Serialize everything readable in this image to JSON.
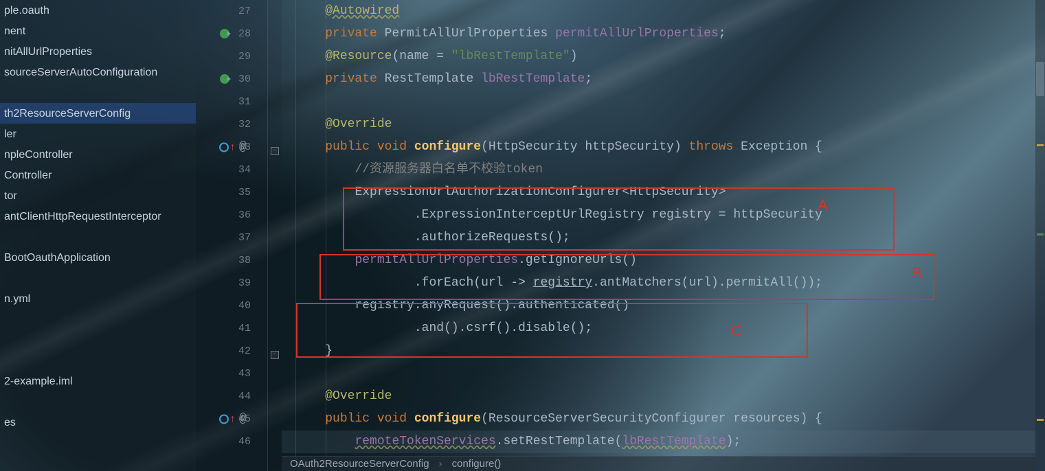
{
  "sidebar": {
    "items": [
      {
        "label": "ple.oauth"
      },
      {
        "label": "nent"
      },
      {
        "label": "nitAllUrlProperties"
      },
      {
        "label": "sourceServerAutoConfiguration"
      },
      {
        "label": ""
      },
      {
        "label": "th2ResourceServerConfig",
        "selected": true
      },
      {
        "label": "ler"
      },
      {
        "label": "npleController"
      },
      {
        "label": "Controller"
      },
      {
        "label": "tor"
      },
      {
        "label": "antClientHttpRequestInterceptor"
      },
      {
        "label": ""
      },
      {
        "label": "BootOauthApplication"
      },
      {
        "label": ""
      },
      {
        "label": "n.yml"
      },
      {
        "label": ""
      },
      {
        "label": ""
      },
      {
        "label": ""
      },
      {
        "label": "2-example.iml"
      },
      {
        "label": ""
      },
      {
        "label": "es"
      }
    ]
  },
  "gutter": {
    "start": 27,
    "count": 20,
    "run_rows": [
      28,
      30
    ],
    "method_rows": [
      33,
      45
    ]
  },
  "code": {
    "lines": [
      [
        {
          "c": "t-anno-u",
          "t": "@Autowired"
        }
      ],
      [
        {
          "c": "t-kw",
          "t": "private"
        },
        {
          "c": "t-punc",
          "t": " "
        },
        {
          "c": "t-type",
          "t": "PermitAllUrlProperties "
        },
        {
          "c": "t-field",
          "t": "permitAllUrlProperties"
        },
        {
          "c": "t-punc",
          "t": ";"
        }
      ],
      [
        {
          "c": "t-anno",
          "t": "@Resource"
        },
        {
          "c": "t-punc",
          "t": "("
        },
        {
          "c": "t-methodc",
          "t": "name"
        },
        {
          "c": "t-punc",
          "t": " = "
        },
        {
          "c": "t-str",
          "t": "\"lbRestTemplate\""
        },
        {
          "c": "t-punc",
          "t": ")"
        }
      ],
      [
        {
          "c": "t-kw",
          "t": "private"
        },
        {
          "c": "t-punc",
          "t": " "
        },
        {
          "c": "t-type",
          "t": "RestTemplate "
        },
        {
          "c": "t-field",
          "t": "lbRestTemplate"
        },
        {
          "c": "t-punc",
          "t": ";"
        }
      ],
      [],
      [
        {
          "c": "t-anno",
          "t": "@Override"
        }
      ],
      [
        {
          "c": "t-kw",
          "t": "public void"
        },
        {
          "c": "t-punc",
          "t": " "
        },
        {
          "c": "t-method",
          "t": "configure"
        },
        {
          "c": "t-paren",
          "t": "("
        },
        {
          "c": "t-type",
          "t": "HttpSecurity httpSecurity"
        },
        {
          "c": "t-paren",
          "t": ") "
        },
        {
          "c": "t-kw",
          "t": "throws"
        },
        {
          "c": "t-punc",
          "t": " Exception {"
        }
      ],
      [
        {
          "c": "t-punc",
          "t": "    "
        },
        {
          "c": "t-comment",
          "t": "//资源服务器白名单不校验token"
        }
      ],
      [
        {
          "c": "t-punc",
          "t": "    "
        },
        {
          "c": "t-type",
          "t": "ExpressionUrlAuthorizationConfigurer"
        },
        {
          "c": "t-punc",
          "t": "<"
        },
        {
          "c": "t-type",
          "t": "HttpSecurity"
        },
        {
          "c": "t-punc",
          "t": ">"
        }
      ],
      [
        {
          "c": "t-punc",
          "t": "            ."
        },
        {
          "c": "t-type",
          "t": "ExpressionInterceptUrlRegistry"
        },
        {
          "c": "t-punc",
          "t": " registry = httpSecurity"
        }
      ],
      [
        {
          "c": "t-punc",
          "t": "            ."
        },
        {
          "c": "t-methodc",
          "t": "authorizeRequests"
        },
        {
          "c": "t-punc",
          "t": "();"
        }
      ],
      [
        {
          "c": "t-punc",
          "t": "    "
        },
        {
          "c": "t-field",
          "t": "permitAllUrlProperties"
        },
        {
          "c": "t-punc",
          "t": "."
        },
        {
          "c": "t-methodc",
          "t": "getIgnoreUrls"
        },
        {
          "c": "t-punc",
          "t": "()"
        }
      ],
      [
        {
          "c": "t-punc",
          "t": "            ."
        },
        {
          "c": "t-methodc",
          "t": "forEach"
        },
        {
          "c": "t-punc",
          "t": "(url -> "
        },
        {
          "c": "t-methodc ul",
          "t": "registry"
        },
        {
          "c": "t-punc",
          "t": "."
        },
        {
          "c": "t-methodc",
          "t": "antMatchers"
        },
        {
          "c": "t-punc",
          "t": "(url)."
        },
        {
          "c": "t-methodc",
          "t": "permitAll"
        },
        {
          "c": "t-punc",
          "t": "());"
        }
      ],
      [
        {
          "c": "t-punc",
          "t": "    registry."
        },
        {
          "c": "t-methodc",
          "t": "anyRequest"
        },
        {
          "c": "t-punc",
          "t": "()."
        },
        {
          "c": "t-methodc",
          "t": "authenticated"
        },
        {
          "c": "t-punc",
          "t": "()"
        }
      ],
      [
        {
          "c": "t-punc",
          "t": "            ."
        },
        {
          "c": "t-methodc",
          "t": "and"
        },
        {
          "c": "t-punc",
          "t": "()."
        },
        {
          "c": "t-methodc",
          "t": "csrf"
        },
        {
          "c": "t-punc",
          "t": "()."
        },
        {
          "c": "t-methodc",
          "t": "disable"
        },
        {
          "c": "t-punc",
          "t": "();"
        }
      ],
      [
        {
          "c": "t-punc",
          "t": "}"
        }
      ],
      [],
      [
        {
          "c": "t-anno",
          "t": "@Override"
        }
      ],
      [
        {
          "c": "t-kw",
          "t": "public void"
        },
        {
          "c": "t-punc",
          "t": " "
        },
        {
          "c": "t-method",
          "t": "configure"
        },
        {
          "c": "t-paren",
          "t": "("
        },
        {
          "c": "t-type",
          "t": "ResourceServerSecurityConfigurer resources"
        },
        {
          "c": "t-paren",
          "t": ") {"
        }
      ],
      [
        {
          "c": "t-punc",
          "t": "    "
        },
        {
          "c": "t-field wavy",
          "t": "remoteTokenServices"
        },
        {
          "c": "t-punc",
          "t": "."
        },
        {
          "c": "t-methodc",
          "t": "setRestTemplate"
        },
        {
          "c": "t-punc",
          "t": "("
        },
        {
          "c": "t-field wavy",
          "t": "lbRestTemplate"
        },
        {
          "c": "t-punc",
          "t": ");"
        }
      ]
    ],
    "base_indent": "    "
  },
  "annotations": {
    "A": {
      "label": "A"
    },
    "B": {
      "label": "B"
    },
    "C": {
      "label": "C"
    }
  },
  "breadcrumbs": {
    "items": [
      "OAuth2ResourceServerConfig",
      "configure()"
    ]
  }
}
